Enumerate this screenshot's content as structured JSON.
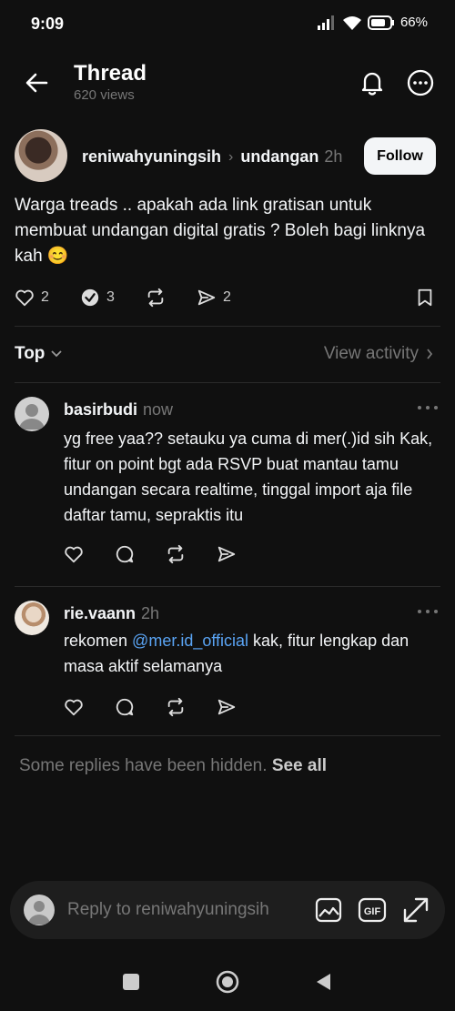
{
  "status_bar": {
    "time": "9:09",
    "battery": "66%"
  },
  "header": {
    "title": "Thread",
    "views": "620 views"
  },
  "post": {
    "author": "reniwahyuningsih",
    "topic": "undangan",
    "time": "2h",
    "follow_label": "Follow",
    "text": "Warga treads .. apakah ada link gratisan untuk membuat undangan digital gratis ? Boleh bagi linknya kah 😊",
    "likes": "2",
    "reposts": "3",
    "shares": "2"
  },
  "sort": {
    "label": "Top",
    "view_activity": "View activity"
  },
  "replies": [
    {
      "author": "basirbudi",
      "time": "now",
      "text": "yg free yaa?? setauku ya cuma di mer(.)id sih Kak, fitur on point bgt ada RSVP buat mantau tamu undangan secara realtime, tinggal import aja file daftar tamu, sepraktis itu"
    },
    {
      "author": "rie.vaann",
      "time": "2h",
      "text_before": "rekomen ",
      "mention": "@mer.id_official",
      "text_after": " kak, fitur lengkap dan masa aktif selamanya"
    }
  ],
  "hidden_note": {
    "text": "Some replies have been hidden.",
    "link": "See all"
  },
  "reply_bar": {
    "placeholder": "Reply to reniwahyuningsih"
  },
  "colors": {
    "background": "#101010",
    "mention": "#5aa4f4",
    "muted": "#777777"
  }
}
